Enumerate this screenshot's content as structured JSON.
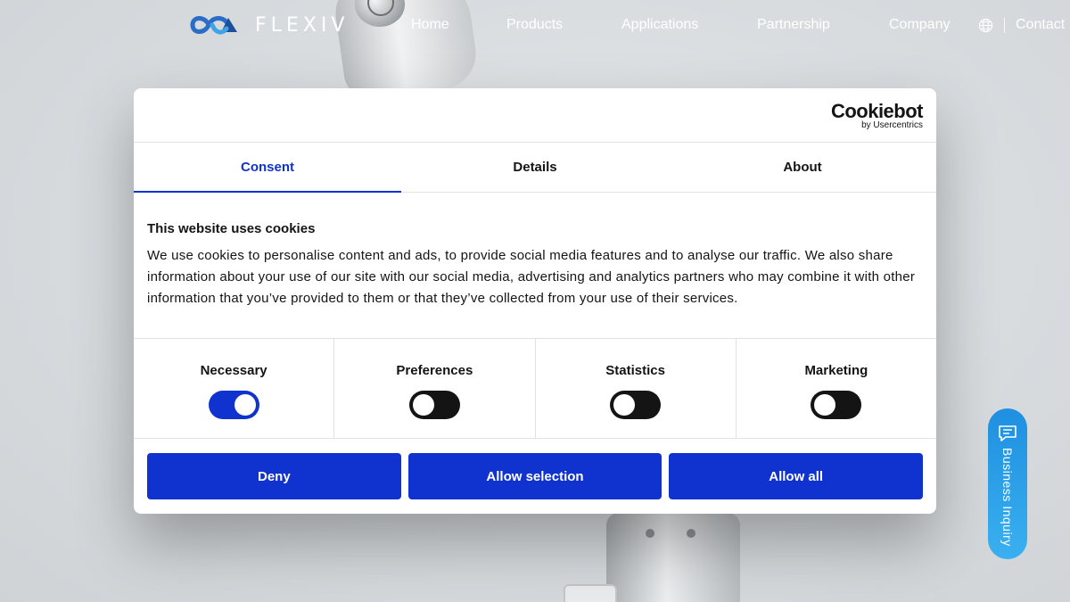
{
  "header": {
    "logo_text": "FLEXIV",
    "nav": [
      "Home",
      "Products",
      "Applications",
      "Partnership",
      "Company"
    ],
    "contact_label": "Contact"
  },
  "cookie_dialog": {
    "brand_name": "Cookiebot",
    "brand_sub": "by Usercentrics",
    "tabs": [
      "Consent",
      "Details",
      "About"
    ],
    "active_tab": "Consent",
    "title": "This website uses cookies",
    "description": "We use cookies to personalise content and ads, to provide social media features and to analyse our traffic. We also share information about your use of our site with our social media, advertising and analytics partners who may combine it with other information that you’ve provided to them or that they’ve collected from your use of their services.",
    "toggles": [
      {
        "label": "Necessary",
        "on": true
      },
      {
        "label": "Preferences",
        "on": false
      },
      {
        "label": "Statistics",
        "on": false
      },
      {
        "label": "Marketing",
        "on": false
      }
    ],
    "buttons": {
      "deny": "Deny",
      "allow_selection": "Allow selection",
      "allow_all": "Allow all"
    },
    "accent_color": "#1032cf"
  },
  "side_tab": {
    "label": "Business Inquiry",
    "icon": "chat-icon"
  }
}
